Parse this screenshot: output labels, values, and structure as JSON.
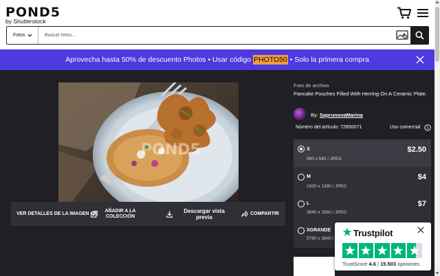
{
  "header": {
    "logo": "POND5",
    "logo_sub": "by Shutterstock",
    "search_category": "Fotos",
    "search_placeholder": "Buscar fotos..."
  },
  "promo": {
    "text_before": "Aprovecha hasta 50% de descuento Photos • Usar código ",
    "code": "PHOTO50",
    "text_after": " • Solo la primera compra"
  },
  "image": {
    "watermark": "POND5"
  },
  "actions": {
    "details": "VER DETALLES DE LA IMAGEN",
    "add_collection": "AÑADIR A LA COLECCIÓN",
    "download_preview": "Descargar vista previa",
    "share": "COMPARTIR"
  },
  "info": {
    "type": "Foto de archivo",
    "title": "Pancake Pouches Filled With Herring On A Ceramic Plate.",
    "by": "By: ",
    "author": "SaprunovaMarina",
    "item_number": "Número del artículo: 72850071",
    "license": "Uso comercial"
  },
  "sizes": [
    {
      "name": "S",
      "spec": "960 x 640 / JPEG",
      "price": "$2.50",
      "selected": true
    },
    {
      "name": "M",
      "spec": "1920 x 1280 / JPEG",
      "price": "$4",
      "selected": false
    },
    {
      "name": "L",
      "spec": "3840 x 2560 / JPEG",
      "price": "$7",
      "selected": false
    },
    {
      "name": "XGRANDE",
      "spec": "5760 x 3840 / JPEG",
      "price": "",
      "selected": false
    }
  ],
  "trustpilot": {
    "brand": "Trustpilot",
    "score_label": "TrustScore",
    "score": "4.6",
    "separator": "|",
    "reviews": "15.503",
    "reviews_label": "opiniones",
    "rating": 4.6
  },
  "colors": {
    "promo_bg": "#4c3ae0",
    "promo_code_bg": "#f59a3c",
    "page_bg": "#1f1f24",
    "panel_bg": "#2f2f36",
    "trustpilot_green": "#00b67a"
  }
}
